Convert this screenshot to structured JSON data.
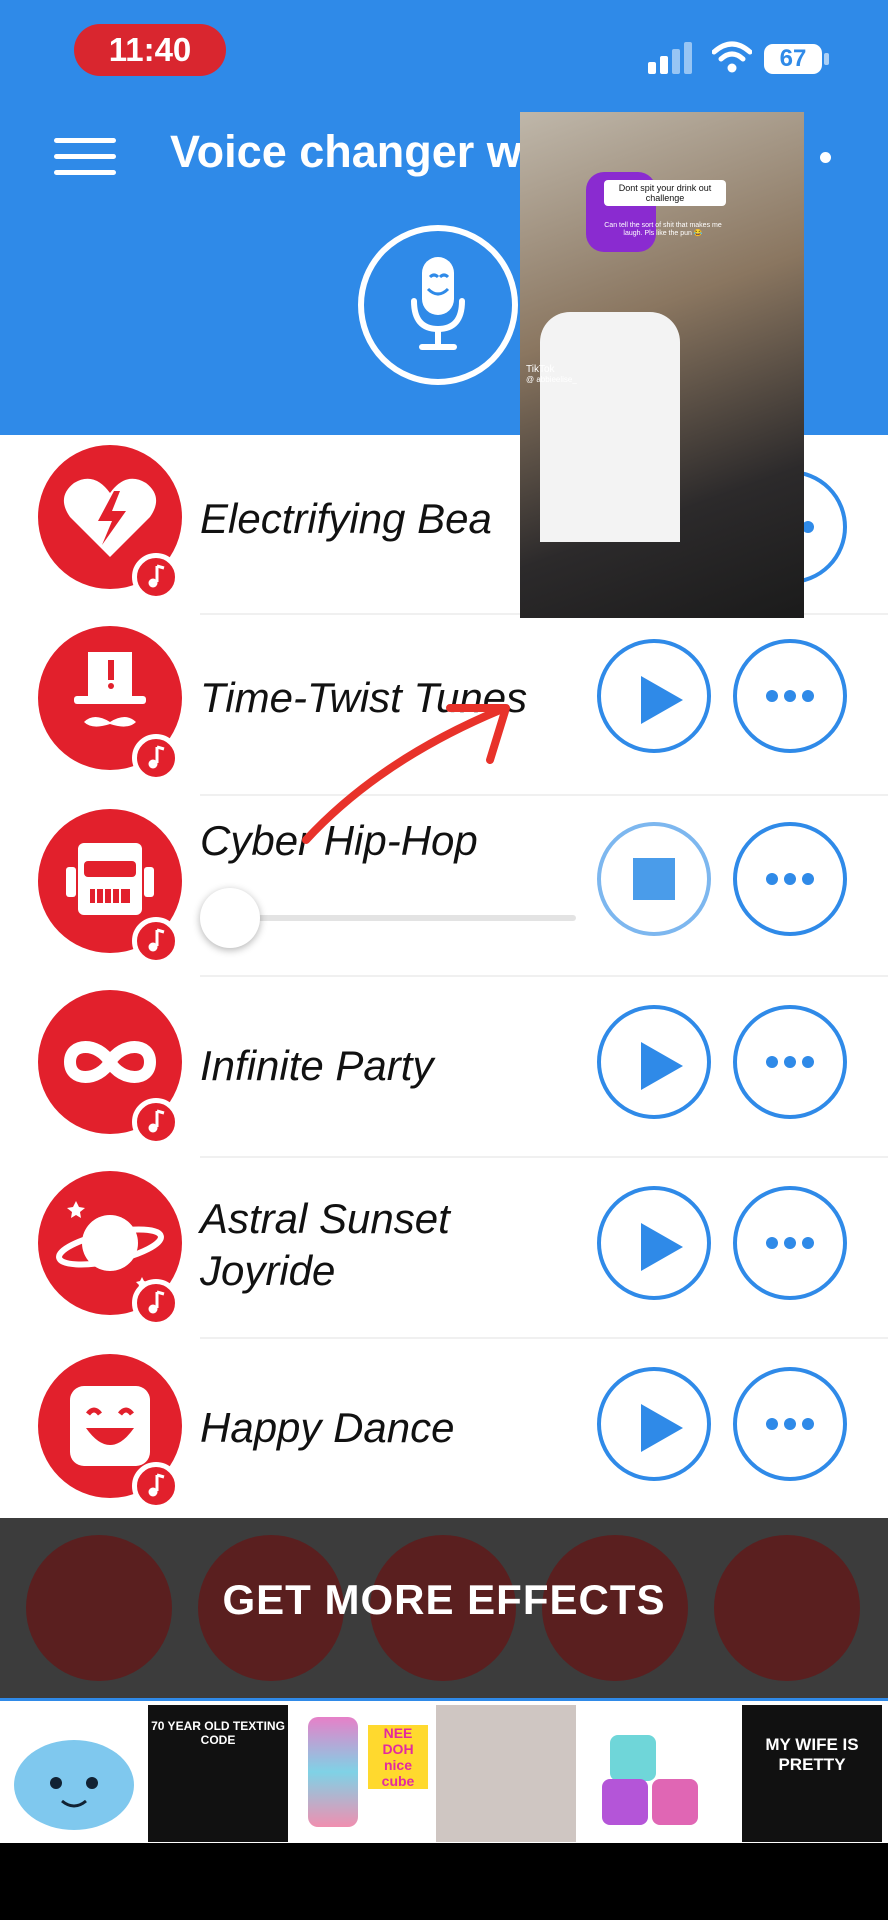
{
  "status_bar": {
    "time": "11:40",
    "battery": "67"
  },
  "header": {
    "title": "Voice changer w",
    "menu_icon": "hamburger-menu-icon",
    "mic_icon": "microphone-icon"
  },
  "effects": [
    {
      "name": "Electrifying Bea",
      "icon": "broken-heart-bolt-icon",
      "state": "idle"
    },
    {
      "name": "Time-Twist Tunes",
      "icon": "top-hat-mustache-icon",
      "state": "idle"
    },
    {
      "name": "Cyber Hip-Hop",
      "icon": "robot-dj-icon",
      "state": "playing",
      "progress": 0
    },
    {
      "name": "Infinite Party",
      "icon": "infinity-icon",
      "state": "idle"
    },
    {
      "name": "Astral Sunset Joyride",
      "name_line1": "Astral Sunset",
      "name_line2": "Joyride",
      "icon": "planet-icon",
      "state": "idle"
    },
    {
      "name": "Happy Dance",
      "icon": "smiley-face-icon",
      "state": "idle"
    }
  ],
  "banner": {
    "label": "GET MORE EFFECTS"
  },
  "pip_video": {
    "caption": "Dont spit your drink out challenge",
    "subtitle": "Can tell the sort of shit that makes me laugh. Pls like the pun 😂",
    "platform": "TikTok",
    "handle": "@ abbieelise_"
  },
  "ads": [
    {
      "label": "plush-toy-ad"
    },
    {
      "label": "70 YEAR OLD TEXTING CODE"
    },
    {
      "label": "NEE DOH nice cube"
    },
    {
      "label": "fitness-model-ad"
    },
    {
      "label": "soap-cubes-ad"
    },
    {
      "label": "MY WIFE IS PRETTY"
    }
  ],
  "colors": {
    "primary_blue": "#2f8ae8",
    "effect_red": "#e2202c",
    "time_pill_red": "#d9262f",
    "banner_gray": "#3c3c3c"
  }
}
